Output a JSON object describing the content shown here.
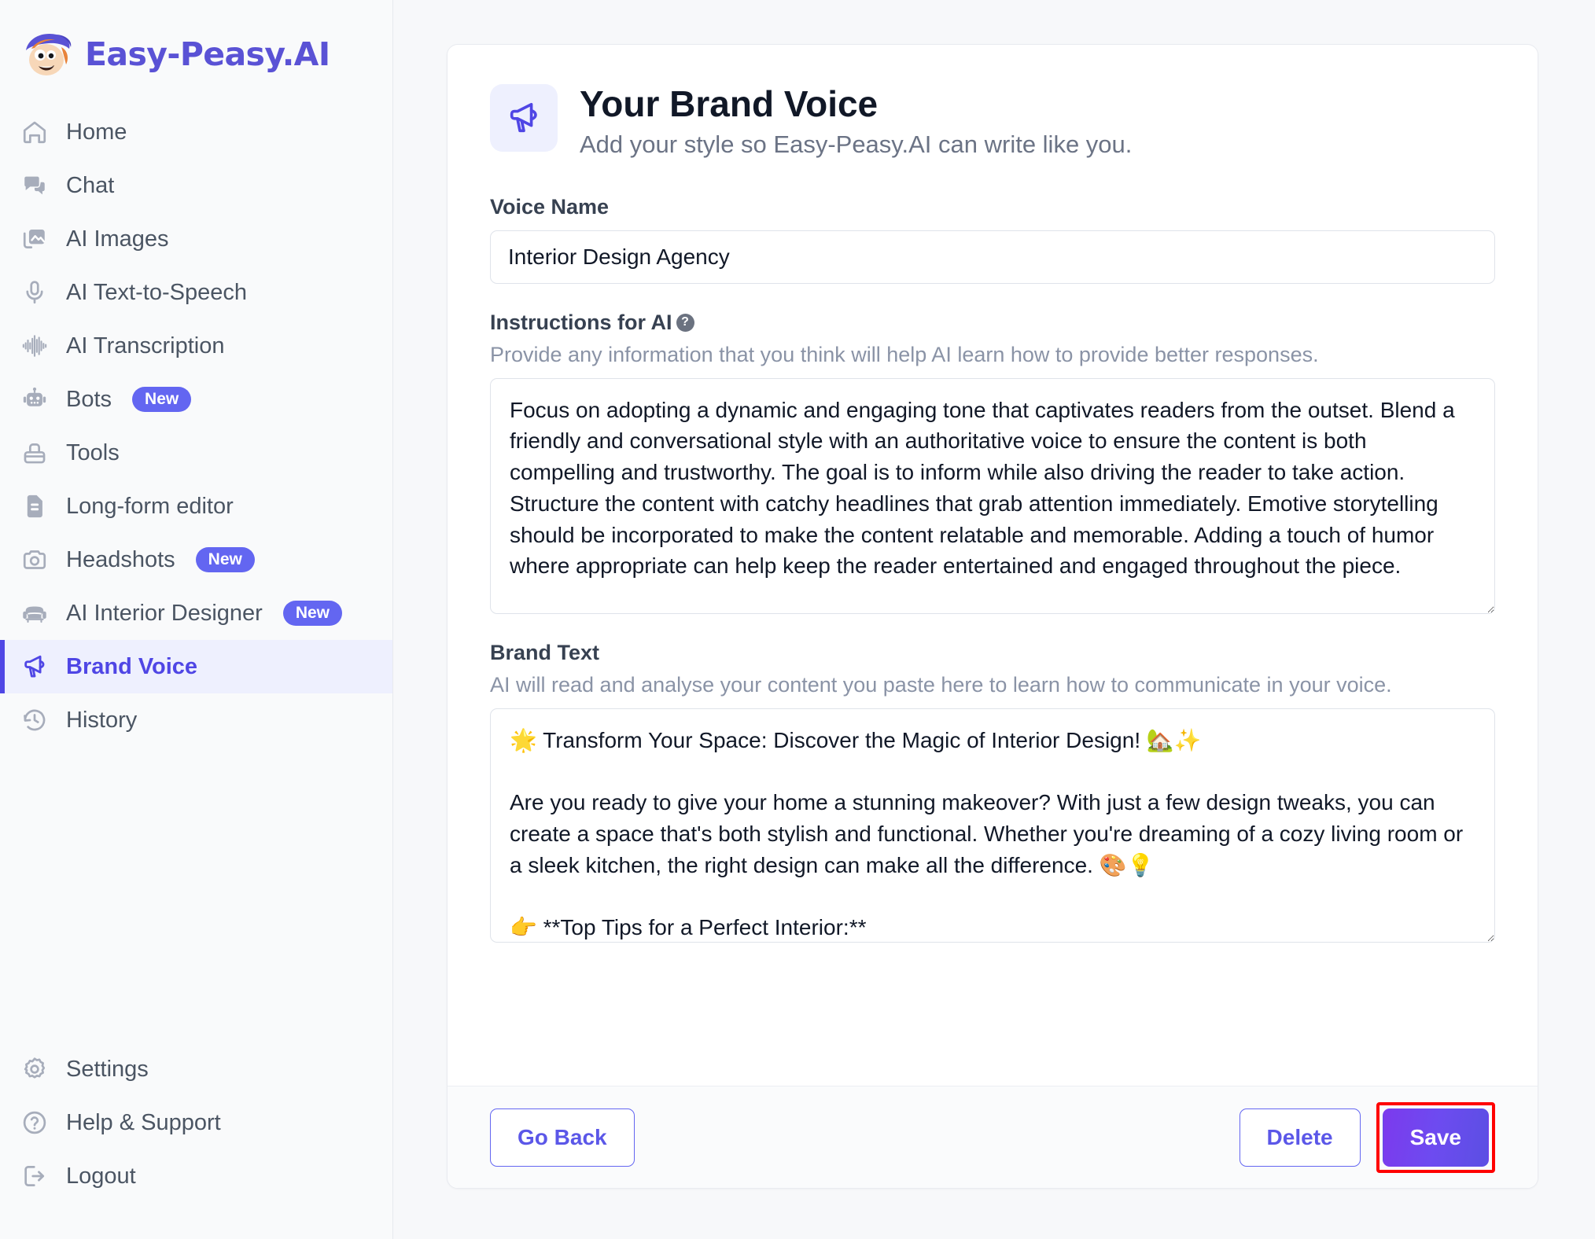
{
  "brand": {
    "name": "Easy-Peasy.AI",
    "logo_icon": "easy-peasy-mascot-logo"
  },
  "sidebar": {
    "items": [
      {
        "label": "Home",
        "icon": "home-icon",
        "badge": "",
        "active": false
      },
      {
        "label": "Chat",
        "icon": "chat-icon",
        "badge": "",
        "active": false
      },
      {
        "label": "AI Images",
        "icon": "image-icon",
        "badge": "",
        "active": false
      },
      {
        "label": "AI Text-to-Speech",
        "icon": "microphone-icon",
        "badge": "",
        "active": false
      },
      {
        "label": "AI Transcription",
        "icon": "waveform-icon",
        "badge": "",
        "active": false
      },
      {
        "label": "Bots",
        "icon": "robot-icon",
        "badge": "New",
        "active": false
      },
      {
        "label": "Tools",
        "icon": "toolbox-icon",
        "badge": "",
        "active": false
      },
      {
        "label": "Long-form editor",
        "icon": "document-icon",
        "badge": "",
        "active": false
      },
      {
        "label": "Headshots",
        "icon": "camera-icon",
        "badge": "New",
        "active": false
      },
      {
        "label": "AI Interior Designer",
        "icon": "armchair-icon",
        "badge": "New",
        "active": false
      },
      {
        "label": "Brand Voice",
        "icon": "megaphone-icon",
        "badge": "",
        "active": true
      },
      {
        "label": "History",
        "icon": "history-clock-icon",
        "badge": "",
        "active": false
      }
    ],
    "bottom_items": [
      {
        "label": "Settings",
        "icon": "gear-icon"
      },
      {
        "label": "Help & Support",
        "icon": "question-circle-icon"
      },
      {
        "label": "Logout",
        "icon": "logout-icon"
      }
    ]
  },
  "page": {
    "icon": "megaphone-icon",
    "title": "Your Brand Voice",
    "subtitle": "Add your style so Easy-Peasy.AI can write like you."
  },
  "form": {
    "voice_name": {
      "label": "Voice Name",
      "value": "Interior Design Agency",
      "placeholder": "Voice Name"
    },
    "instructions": {
      "label": "Instructions for AI",
      "help_icon": "question-mark-icon",
      "hint": "Provide any information that you think will help AI learn how to provide better responses.",
      "value": "Focus on adopting a dynamic and engaging tone that captivates readers from the outset. Blend a friendly and conversational style with an authoritative voice to ensure the content is both compelling and trustworthy. The goal is to inform while also driving the reader to take action.\nStructure the content with catchy headlines that grab attention immediately. Emotive storytelling should be incorporated to make the content relatable and memorable. Adding a touch of humor where appropriate can help keep the reader entertained and engaged throughout the piece.",
      "placeholder": "Instructions for AI"
    },
    "brand_text": {
      "label": "Brand Text",
      "hint": "AI will read and analyse your content you paste here to learn how to communicate in your voice.",
      "value": "🌟 Transform Your Space: Discover the Magic of Interior Design! 🏡✨\n\nAre you ready to give your home a stunning makeover? With just a few design tweaks, you can create a space that's both stylish and functional. Whether you're dreaming of a cozy living room or a sleek kitchen, the right design can make all the difference. 🎨💡\n\n👉 **Top Tips for a Perfect Interior:**",
      "placeholder": "Brand Text"
    }
  },
  "footer": {
    "go_back_label": "Go Back",
    "delete_label": "Delete",
    "save_label": "Save",
    "save_highlight_color": "#ff0000"
  },
  "colors": {
    "accent": "#6366f1",
    "accent_dark": "#4f46e5",
    "sidebar_bg": "#f9fafb",
    "active_bg": "#eef0fe",
    "main_bg": "#f7f8fa"
  }
}
